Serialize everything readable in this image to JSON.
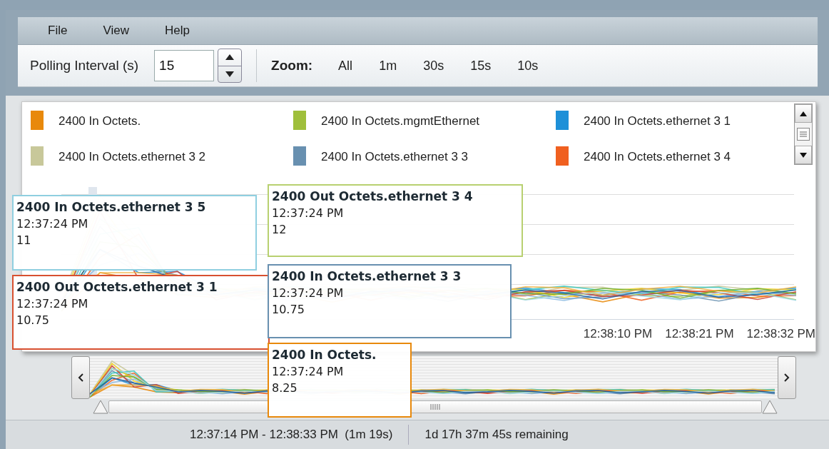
{
  "menu": [
    "File",
    "View",
    "Help"
  ],
  "toolbar": {
    "polling_label": "Polling Interval (s)",
    "polling_value": "15",
    "zoom_label": "Zoom:",
    "zoom_options": [
      "All",
      "1m",
      "30s",
      "15s",
      "10s"
    ]
  },
  "legend": [
    {
      "label": "2400 In Octets.",
      "color": "#e8890c"
    },
    {
      "label": "2400 In Octets.mgmtEthernet",
      "color": "#9fbf3b"
    },
    {
      "label": "2400 In Octets.ethernet 3 1",
      "color": "#1e90d8"
    },
    {
      "label": "2400 In Octets.ethernet 3 2",
      "color": "#c8c89a"
    },
    {
      "label": "2400 In Octets.ethernet 3 3",
      "color": "#6890b0"
    },
    {
      "label": "2400 In Octets.ethernet 3 4",
      "color": "#f06020"
    }
  ],
  "chart": {
    "x_labels": [
      "12:38:10 PM",
      "12:38:21 PM",
      "12:38:32 PM"
    ]
  },
  "tooltips": [
    {
      "title": "2400 In Octets.ethernet 3 5",
      "time": "12:37:24 PM",
      "value": "11",
      "color": "#8fcfe0"
    },
    {
      "title": "2400 Out Octets.ethernet 3 4",
      "time": "12:37:24 PM",
      "value": "12",
      "color": "#b8d070"
    },
    {
      "title": "2400 Out Octets.ethernet 3 1",
      "time": "12:37:24 PM",
      "value": "10.75",
      "color": "#d85030"
    },
    {
      "title": "2400 In Octets.ethernet 3 3",
      "time": "12:37:24 PM",
      "value": "10.75",
      "color": "#6890b0"
    },
    {
      "title": "2400 In Octets.",
      "time": "12:37:24 PM",
      "value": "8.25",
      "color": "#e8890c"
    }
  ],
  "status_bar": {
    "range": "12:37:14 PM - 12:38:33 PM  (1m 19s)",
    "remaining": "1d 17h 37m 45s remaining"
  }
}
